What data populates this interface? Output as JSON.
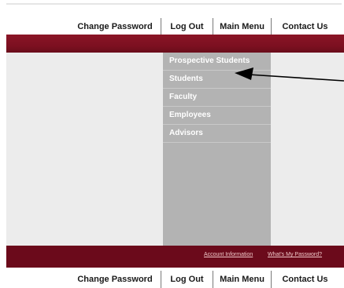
{
  "nav": {
    "change_password": "Change Password",
    "log_out": "Log Out",
    "main_menu": "Main Menu",
    "contact_us": "Contact Us"
  },
  "menu": {
    "items": [
      {
        "label": "Prospective Students"
      },
      {
        "label": "Students"
      },
      {
        "label": "Faculty"
      },
      {
        "label": "Employees"
      },
      {
        "label": "Advisors"
      }
    ]
  },
  "footer": {
    "account_information": "Account Information",
    "whats_my_password": "What's My Password?"
  },
  "colors": {
    "maroon": "#6b0a1b",
    "menu_gray": "#b3b3b3",
    "panel_gray": "#ececec"
  },
  "annotation": {
    "arrow_icon": "left-arrow-icon"
  }
}
